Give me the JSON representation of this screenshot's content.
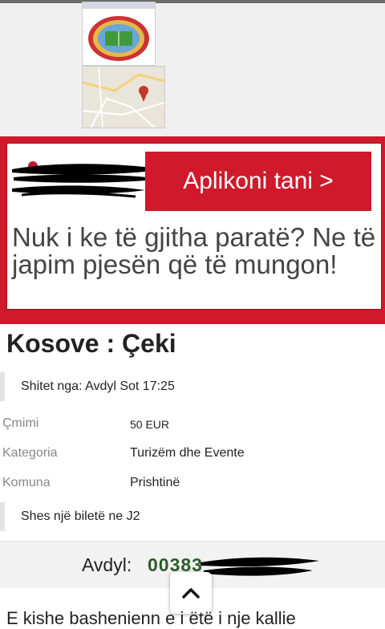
{
  "ad": {
    "cta_label": "Aplikoni tani >",
    "headline": "Nuk i ke të gjitha paratë? Ne të japim pjesën që të mungon!"
  },
  "listing": {
    "title": "Kosove : Çeki",
    "seller": "Shitet nga: Avdyl Sot 17:25",
    "fields": [
      {
        "label": "Çmimi",
        "value": "50 EUR"
      },
      {
        "label": "Kategoria",
        "value": "Turizëm dhe Evente"
      },
      {
        "label": "Komuna",
        "value": "Prishtinë"
      }
    ],
    "description": "Shes një biletë ne J2"
  },
  "contact": {
    "name": "Avdyl:",
    "phone_prefix": "00383"
  },
  "footer": {
    "cut_text": "E kishe bashenienn e i ëtë i nje kallie"
  },
  "icons": {
    "scroll_top": "chevron-up-icon",
    "ad_logo": "redacted-logo",
    "map_pin": "map-pin-icon"
  },
  "colors": {
    "ad_red": "#d0192b",
    "phone_green": "#2c5d2a"
  }
}
